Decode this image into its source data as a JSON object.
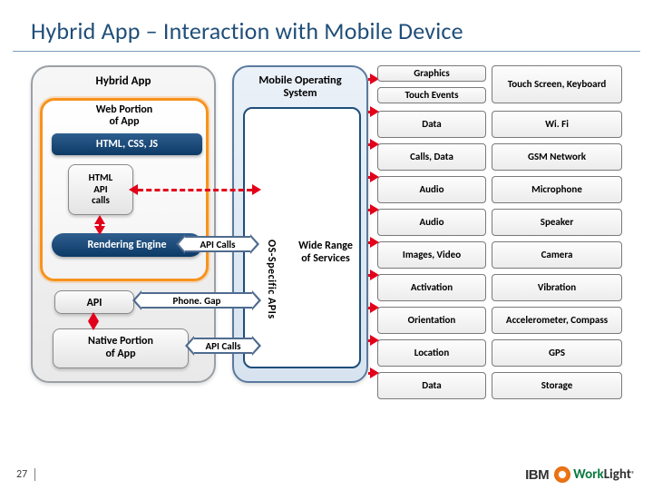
{
  "title": "Hybrid App – Interaction with Mobile Device",
  "hybrid": {
    "title": "Hybrid App",
    "web_portion": "Web Portion\nof App",
    "html_css_js": "HTML, CSS, JS",
    "html_api_calls": "HTML\nAPI\ncalls",
    "rendering_engine": "Rendering Engine",
    "api": "API",
    "native_portion": "Native Portion\nof App"
  },
  "os": {
    "title": "Mobile  Operating\nSystem",
    "vertical_label": "OS-Specific APIs",
    "wide_range": "Wide Range\nof Services"
  },
  "arrows": {
    "api_calls": "API Calls",
    "phone_gap": "Phone. Gap"
  },
  "rows": [
    {
      "service": "Graphics",
      "hw": "Touch Screen, Keyboard"
    },
    {
      "service": "Touch Events",
      "hw": ""
    },
    {
      "service": "Data",
      "hw": "Wi. Fi"
    },
    {
      "service": "Calls, Data",
      "hw": "GSM Network"
    },
    {
      "service": "Audio",
      "hw": "Microphone"
    },
    {
      "service": "Audio",
      "hw": "Speaker"
    },
    {
      "service": "Images, Video",
      "hw": "Camera"
    },
    {
      "service": "Activation",
      "hw": "Vibration"
    },
    {
      "service": "Orientation",
      "hw": "Accelerometer, Compass"
    },
    {
      "service": "Location",
      "hw": "GPS"
    },
    {
      "service": "Data",
      "hw": "Storage"
    }
  ],
  "footer": {
    "slide_number": "27",
    "brand_left": "IBM",
    "brand_work": "Work",
    "brand_light": "Light",
    "tm": "®"
  }
}
